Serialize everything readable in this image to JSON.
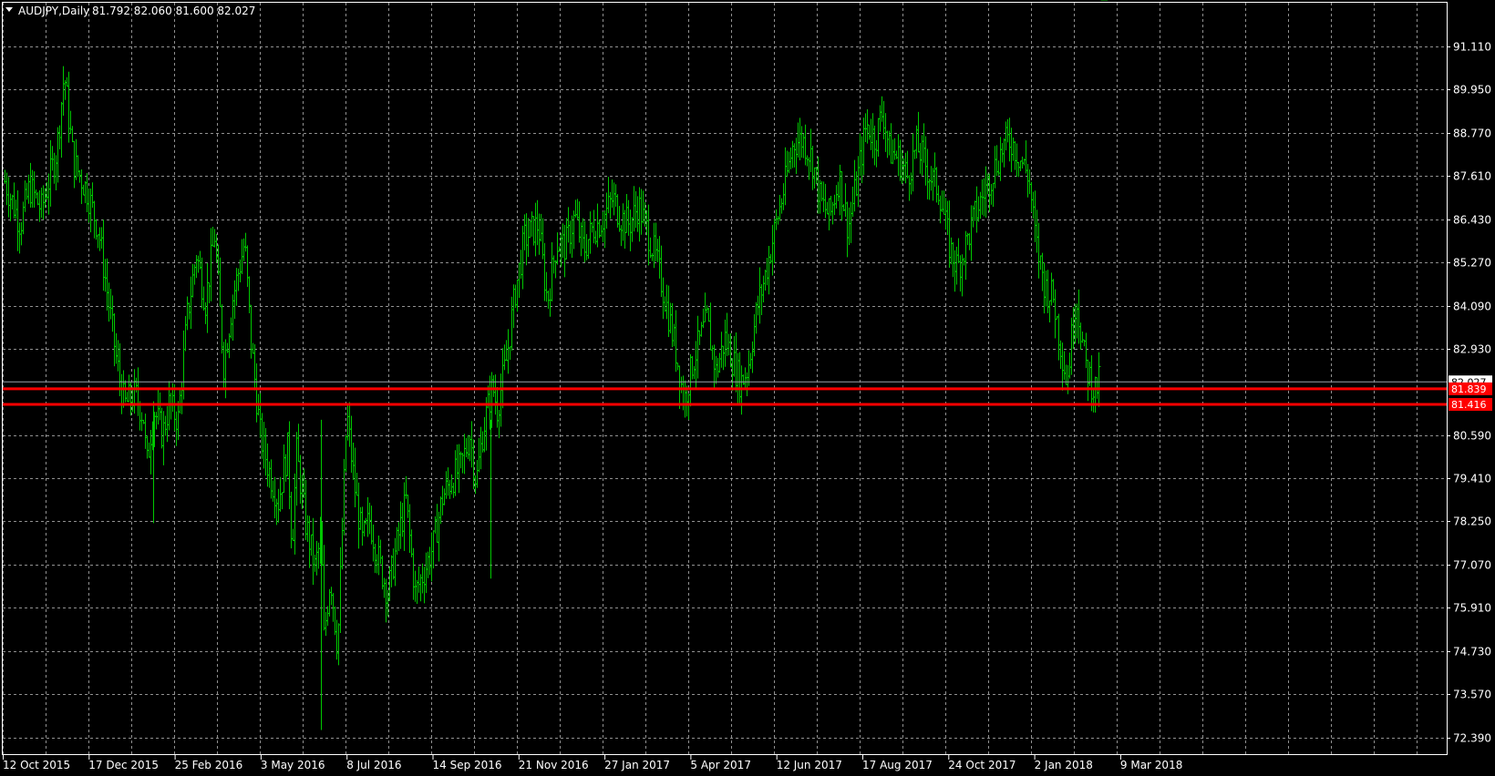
{
  "header": {
    "symbol_timeframe": "AUDJPY,Daily",
    "ohlc": "81.792 82.060 81.600 82.027"
  },
  "colors": {
    "background": "#000000",
    "grid": "#c0c0c0",
    "bars": "#00c800",
    "axis_text": "#ffffff",
    "support_line": "#ff0000",
    "bid_line": "#9aa0a8"
  },
  "chart_data": {
    "type": "line",
    "title": "AUDJPY,Daily",
    "bar_style": "ohlc",
    "grid": true,
    "ylim": [
      71.85,
      91.6
    ],
    "y_ticks": [
      "91.110",
      "89.950",
      "88.770",
      "87.610",
      "86.430",
      "85.270",
      "84.090",
      "82.930",
      "80.590",
      "79.410",
      "78.250",
      "77.070",
      "75.910",
      "74.730",
      "73.570",
      "72.390"
    ],
    "x_ticks": [
      "12 Oct 2015",
      "17 Dec 2015",
      "25 Feb 2016",
      "3 May 2016",
      "8 Jul 2016",
      "14 Sep 2016",
      "21 Nov 2016",
      "27 Jan 2017",
      "5 Apr 2017",
      "12 Jun 2017",
      "17 Aug 2017",
      "24 Oct 2017",
      "2 Jan 2018",
      "9 Mar 2018"
    ],
    "price_path": {
      "x": [
        0,
        22,
        32,
        45,
        62,
        70,
        80,
        95,
        108,
        128,
        136,
        148,
        158,
        160,
        168,
        178,
        185,
        195,
        205,
        215,
        225,
        235,
        245,
        255,
        268,
        275,
        285,
        295,
        305,
        315,
        320,
        325,
        335,
        345,
        352,
        355,
        362,
        370,
        380,
        388,
        397,
        405,
        415,
        425,
        430,
        438,
        445,
        455,
        465,
        475,
        485,
        495,
        505,
        515,
        522,
        530,
        540,
        545,
        555,
        565,
        575,
        590,
        600,
        610,
        620,
        630,
        640,
        650,
        660,
        672,
        680,
        690,
        700,
        710,
        720,
        730,
        740,
        750,
        760,
        775,
        785,
        795,
        805,
        812,
        820,
        830,
        838,
        850,
        860,
        870,
        880,
        890,
        900,
        910,
        920,
        930,
        940,
        950,
        960,
        968,
        975,
        985,
        995,
        1005,
        1010,
        1020,
        1030,
        1042,
        1050,
        1060,
        1070,
        1080,
        1090,
        1100,
        1108,
        1118,
        1128,
        1136,
        1146,
        1155,
        1162,
        1170,
        1180,
        1190,
        1200,
        1205,
        1210,
        1214
      ],
      "close": [
        87.8,
        86.3,
        87.3,
        86.7,
        88.3,
        90.4,
        88.0,
        87.2,
        86.1,
        82.5,
        81.4,
        81.7,
        81.0,
        79.6,
        81.3,
        80.6,
        81.4,
        81.0,
        83.8,
        85.5,
        84.2,
        86.0,
        82.5,
        84.3,
        85.8,
        83.1,
        80.6,
        79.6,
        78.8,
        80.2,
        77.6,
        80.1,
        78.2,
        77.0,
        77.8,
        75.1,
        76.8,
        74.8,
        81.2,
        79.3,
        77.7,
        78.3,
        77.2,
        76.3,
        77.0,
        78.0,
        78.8,
        76.3,
        76.9,
        77.6,
        78.9,
        79.4,
        79.7,
        80.6,
        79.3,
        80.8,
        81.9,
        81.3,
        82.6,
        84.5,
        85.9,
        86.3,
        84.2,
        85.8,
        85.7,
        86.5,
        85.6,
        86.2,
        86.4,
        87.0,
        86.5,
        86.3,
        86.8,
        86.1,
        85.3,
        84.2,
        83.0,
        81.5,
        82.6,
        83.7,
        82.3,
        83.2,
        82.5,
        82.0,
        82.4,
        84.0,
        84.8,
        86.2,
        87.3,
        88.5,
        88.6,
        88.1,
        86.9,
        86.5,
        87.6,
        86.2,
        87.5,
        89.0,
        88.6,
        89.4,
        88.3,
        88.1,
        87.6,
        88.4,
        88.2,
        87.6,
        87.2,
        85.6,
        85.1,
        85.8,
        86.6,
        87.2,
        87.8,
        88.4,
        88.6,
        88.1,
        87.6,
        85.8,
        84.6,
        84.3,
        83.2,
        82.0,
        84.4,
        82.5,
        81.8,
        82.0
      ]
    },
    "horizontal_lines": [
      {
        "price": 82.027,
        "label": "82.027",
        "role": "bid"
      },
      {
        "price": 81.839,
        "label": "81.839",
        "role": "support"
      },
      {
        "price": 81.416,
        "label": "81.416",
        "role": "support"
      }
    ]
  }
}
